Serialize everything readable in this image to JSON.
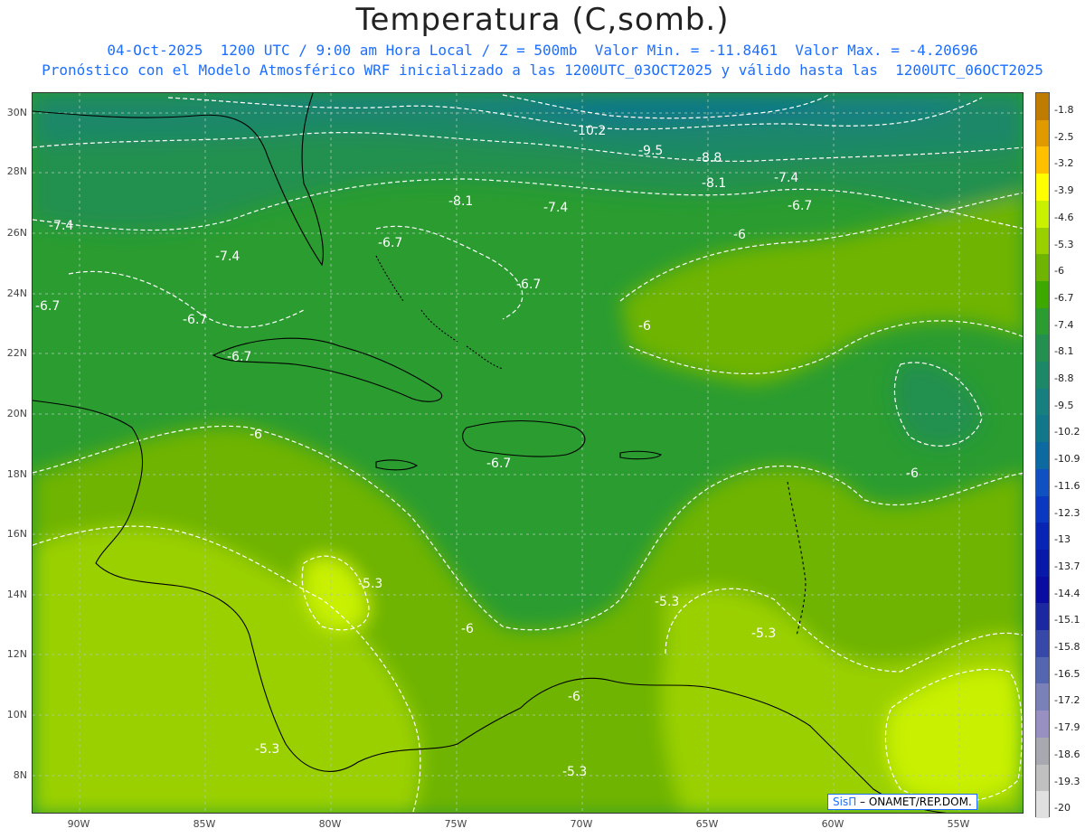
{
  "header": {
    "title": "Temperatura (C,somb.)",
    "line1": "04-Oct-2025  1200 UTC / 9:00 am Hora Local / Z = 500mb  Valor Min. = -11.8461  Valor Max. = -4.20696",
    "line2": "Pronóstico con el Modelo Atmosférico WRF inicializado a las 1200UTC_03OCT2025 y válido hasta las  1200UTC_06OCT2025"
  },
  "map": {
    "lat_labels": [
      "30N",
      "28N",
      "26N",
      "24N",
      "22N",
      "20N",
      "18N",
      "16N",
      "14N",
      "12N",
      "10N",
      "8N"
    ],
    "lon_labels": [
      "90W",
      "85W",
      "80W",
      "75W",
      "70W",
      "65W",
      "60W",
      "55W"
    ],
    "contour_labels": [
      {
        "text": "-10.2"
      },
      {
        "text": "-9.5"
      },
      {
        "text": "-8.8"
      },
      {
        "text": "-8.1"
      },
      {
        "text": "-8.1"
      },
      {
        "text": "-7.4"
      },
      {
        "text": "-7.4"
      },
      {
        "text": "-7.4"
      },
      {
        "text": "-7.4"
      },
      {
        "text": "-6.7"
      },
      {
        "text": "-6.7"
      },
      {
        "text": "-6.7"
      },
      {
        "text": "-6.7"
      },
      {
        "text": "-6.7"
      },
      {
        "text": "-6.7"
      },
      {
        "text": "-6.7"
      },
      {
        "text": "-6"
      },
      {
        "text": "-6"
      },
      {
        "text": "-6"
      },
      {
        "text": "-6"
      },
      {
        "text": "-6"
      },
      {
        "text": "-6"
      },
      {
        "text": "-5.3"
      },
      {
        "text": "-5.3"
      },
      {
        "text": "-5.3"
      },
      {
        "text": "-5.3"
      },
      {
        "text": "-5.3"
      }
    ]
  },
  "colorbar": {
    "levels": [
      "-1.8",
      "-2.5",
      "-3.2",
      "-3.9",
      "-4.6",
      "-5.3",
      "-6",
      "-6.7",
      "-7.4",
      "-8.1",
      "-8.8",
      "-9.5",
      "-10.2",
      "-10.9",
      "-11.6",
      "-12.3",
      "-13",
      "-13.7",
      "-14.4",
      "-15.1",
      "-15.8",
      "-16.5",
      "-17.2",
      "-17.9",
      "-18.6",
      "-19.3",
      "-20"
    ],
    "colors": [
      "#c07c00",
      "#e09a00",
      "#ffc000",
      "#ffff00",
      "#c8f000",
      "#9ad000",
      "#6eb400",
      "#3ca800",
      "#2a9c30",
      "#249050",
      "#1c8868",
      "#168080",
      "#107888",
      "#0c6aa0",
      "#1050c0",
      "#0a38c0",
      "#0824b4",
      "#0818a8",
      "#080ca0",
      "#1c28a0",
      "#3848a8",
      "#5466b0",
      "#7a80b8",
      "#9890c0",
      "#a8a8b0",
      "#c0c0c0",
      "#e0e0e0"
    ],
    "units_note": ""
  },
  "credit": {
    "logo": "SisΠ",
    "text": " – ONAMET/REP.DOM."
  }
}
